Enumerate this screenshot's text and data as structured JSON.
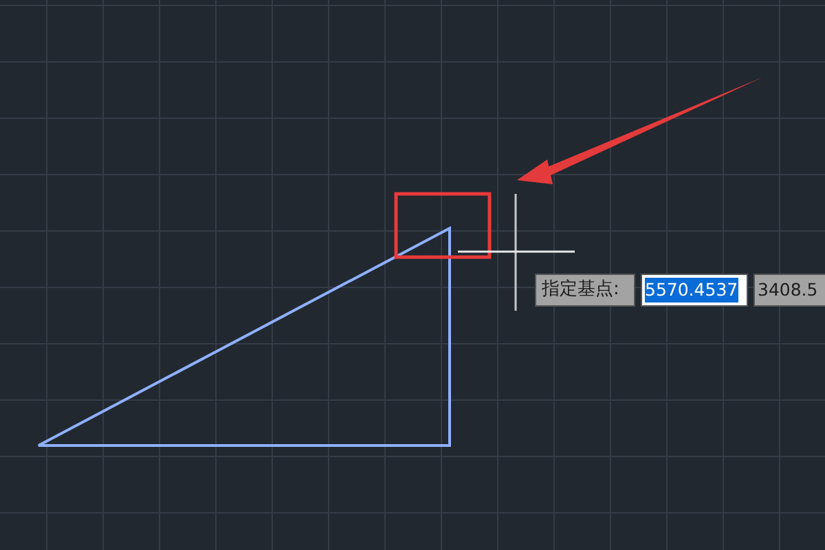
{
  "prompt": {
    "label": "指定基点:"
  },
  "coordinates": [
    {
      "value": "5570.4537",
      "selected": true
    },
    {
      "value": "3408.5",
      "selected": false
    }
  ]
}
